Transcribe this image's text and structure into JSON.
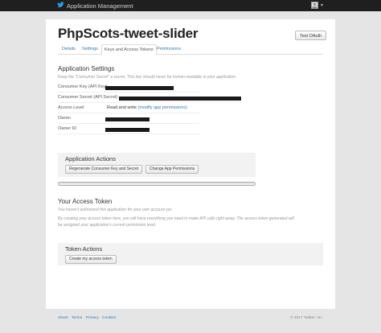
{
  "topbar": {
    "brand": "Application Management",
    "avatar_icon": "user-avatar-icon",
    "menu_caret": "▼"
  },
  "app": {
    "title": "PhpScots-tweet-slider",
    "test_oauth": "Test OAuth"
  },
  "tabs": [
    "Details",
    "Settings",
    "Keys and Access Tokens",
    "Permissions"
  ],
  "active_tab": "Keys and Access Tokens",
  "app_settings": {
    "heading": "Application Settings",
    "note": "Keep the \"Consumer Secret\" a secret. This key should never be human-readable in your application.",
    "rows": [
      {
        "label": "Consumer Key (API Key)",
        "value": ""
      },
      {
        "label": "Consumer Secret (API Secret)",
        "value": ""
      },
      {
        "label": "Access Level",
        "value": "Read and write",
        "link": "(modify app permissions)"
      },
      {
        "label": "Owner",
        "value": ""
      },
      {
        "label": "Owner ID",
        "value": ""
      }
    ]
  },
  "app_actions": {
    "heading": "Application Actions",
    "regenerate": "Regenerate Consumer Key and Secret",
    "change_permissions": "Change App Permissions"
  },
  "access_token": {
    "heading": "Your Access Token",
    "note1": "You haven't authorized this application for your own account yet.",
    "note2": "By creating your access token here, you will have everything you need to make API calls right away. The access token generated will be assigned your application's current permission level."
  },
  "token_actions": {
    "heading": "Token Actions",
    "create": "Create my access token"
  },
  "footer": {
    "links": [
      "About",
      "Terms",
      "Privacy",
      "Cookies"
    ],
    "copyright": "© 2017 Twitter, Inc."
  },
  "colors": {
    "link": "#2b7bb9",
    "topbar": "#1f1f1f",
    "background": "#e5e5e5"
  }
}
